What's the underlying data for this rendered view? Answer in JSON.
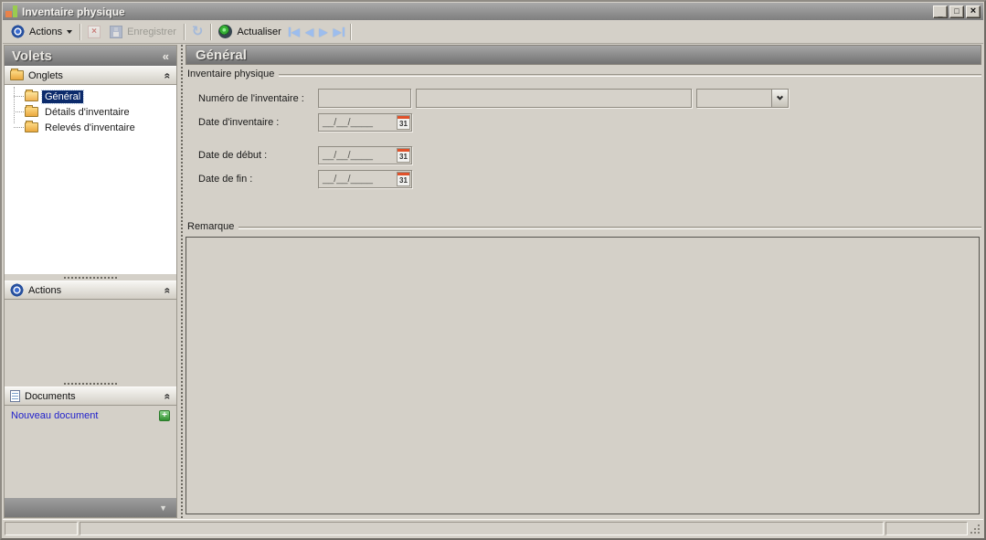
{
  "window": {
    "title": "Inventaire physique"
  },
  "toolbar": {
    "actions_label": "Actions",
    "save_label": "Enregistrer",
    "refresh_label": "Actualiser"
  },
  "icons": {
    "pane_collapse": "«",
    "section_collapse": "«",
    "panel_expand": "▼",
    "nav_first": "◀",
    "nav_prev": "◀",
    "nav_next": "▶",
    "nav_last": "▶",
    "sync_arrows": "↻",
    "delete_x": "×",
    "calendar_day": "31",
    "new_document_plus": "+",
    "minimize": "_",
    "maximize": "□",
    "close": "×"
  },
  "sidebar": {
    "title": "Volets",
    "onglets": {
      "label": "Onglets",
      "items": [
        {
          "label": "Général",
          "selected": true
        },
        {
          "label": "Détails d'inventaire",
          "selected": false
        },
        {
          "label": "Relevés d'inventaire",
          "selected": false
        }
      ]
    },
    "actions": {
      "label": "Actions"
    },
    "documents": {
      "label": "Documents",
      "new_document_label": "Nouveau document"
    }
  },
  "main": {
    "header": "Général",
    "inventory_group": {
      "legend": "Inventaire physique",
      "numero_label": "Numéro de l'inventaire :",
      "numero_value": "",
      "numero_text_value": "",
      "numero_select_value": "",
      "date_inventaire_label": "Date d'inventaire :",
      "date_inventaire_value": "__/__/____",
      "date_debut_label": "Date de début :",
      "date_debut_value": "__/__/____",
      "date_fin_label": "Date de fin :",
      "date_fin_value": "__/__/____"
    },
    "remarque_group": {
      "legend": "Remarque",
      "value": ""
    }
  },
  "statusbar": {
    "panel1": "",
    "panel2": "",
    "panel3": ""
  }
}
